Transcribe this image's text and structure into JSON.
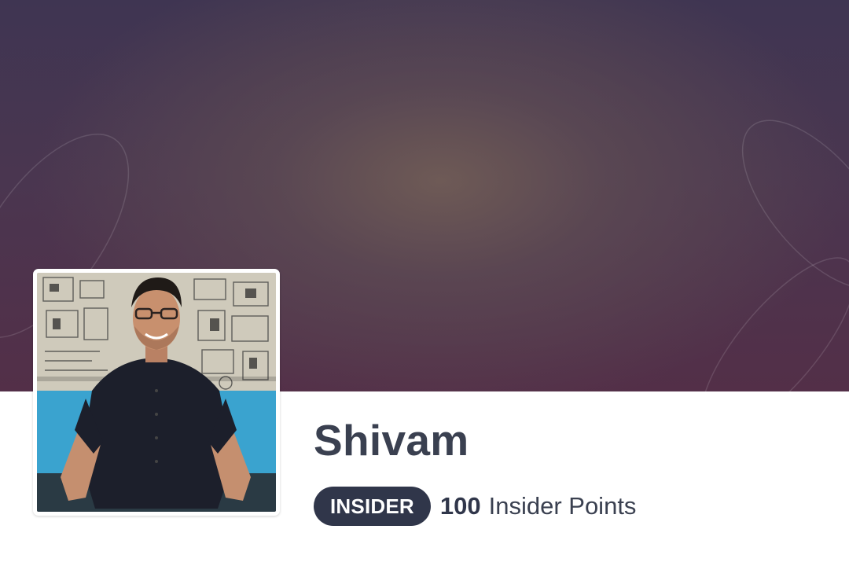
{
  "profile": {
    "name": "Shivam",
    "badge": "INSIDER",
    "points_value": "100",
    "points_label": "Insider Points",
    "photo_icon": "profile-photo"
  },
  "colors": {
    "badge_bg": "#30364a",
    "name_text": "#3a4050",
    "cover_top": "#3f3552",
    "cover_bottom": "#532f48"
  }
}
